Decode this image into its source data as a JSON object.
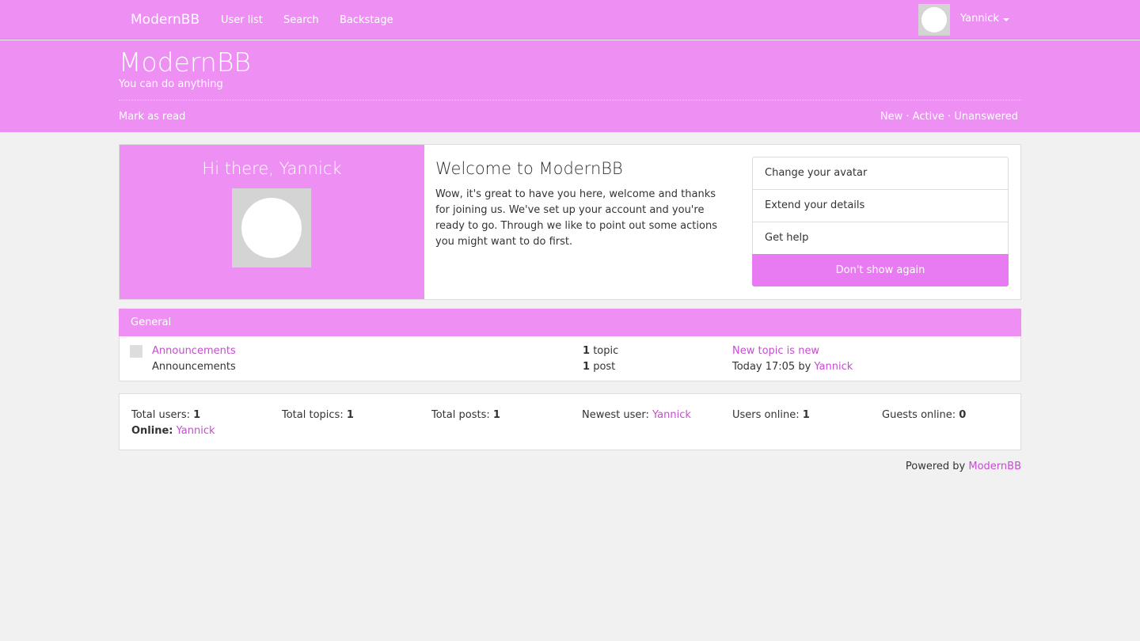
{
  "navbar": {
    "brand": "ModernBB",
    "links": [
      "User list",
      "Search",
      "Backstage"
    ],
    "user": "Yannick"
  },
  "header": {
    "title": "ModernBB",
    "description": "You can do anything",
    "mark_read": "Mark as read",
    "quick_links": [
      "New",
      "Active",
      "Unanswered"
    ],
    "separator": "·"
  },
  "welcome": {
    "greeting": "Hi there, Yannick",
    "title": "Welcome to ModernBB",
    "text": "Wow, it's great to have you here, welcome and thanks for joining us. We've set up your account and you're ready to go. Through we like to point out some actions you might want to do first.",
    "actions": [
      "Change your avatar",
      "Extend your details",
      "Get help"
    ],
    "dismiss": "Don't show again"
  },
  "forum": {
    "category": "General",
    "name": "Announcements",
    "description": "Announcements",
    "topics_count": "1",
    "topics_label": "topic",
    "posts_count": "1",
    "posts_label": "post",
    "last_topic": "New topic is new",
    "last_time": "Today 17:05 by",
    "last_user": "Yannick"
  },
  "stats": {
    "total_users_label": "Total users:",
    "total_users": "1",
    "total_topics_label": "Total topics:",
    "total_topics": "1",
    "total_posts_label": "Total posts:",
    "total_posts": "1",
    "newest_user_label": "Newest user:",
    "newest_user": "Yannick",
    "users_online_label": "Users online:",
    "users_online": "1",
    "guests_online_label": "Guests online:",
    "guests_online": "0",
    "online_label": "Online:",
    "online_user": "Yannick"
  },
  "footer": {
    "powered_by": "Powered by",
    "product": "ModernBB"
  },
  "colors": {
    "accent": "#ee8ff4",
    "link": "#c54dcf",
    "background": "#f1f1f1"
  }
}
